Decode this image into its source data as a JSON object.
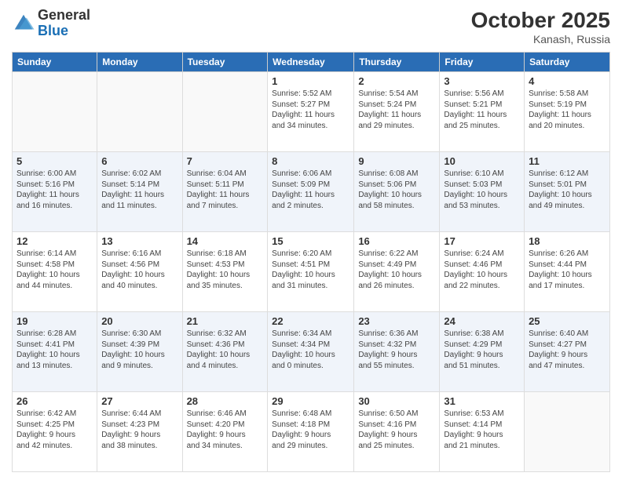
{
  "header": {
    "logo_general": "General",
    "logo_blue": "Blue",
    "title": "October 2025",
    "location": "Kanash, Russia"
  },
  "days_of_week": [
    "Sunday",
    "Monday",
    "Tuesday",
    "Wednesday",
    "Thursday",
    "Friday",
    "Saturday"
  ],
  "weeks": [
    [
      {
        "day": "",
        "info": ""
      },
      {
        "day": "",
        "info": ""
      },
      {
        "day": "",
        "info": ""
      },
      {
        "day": "1",
        "info": "Sunrise: 5:52 AM\nSunset: 5:27 PM\nDaylight: 11 hours\nand 34 minutes."
      },
      {
        "day": "2",
        "info": "Sunrise: 5:54 AM\nSunset: 5:24 PM\nDaylight: 11 hours\nand 29 minutes."
      },
      {
        "day": "3",
        "info": "Sunrise: 5:56 AM\nSunset: 5:21 PM\nDaylight: 11 hours\nand 25 minutes."
      },
      {
        "day": "4",
        "info": "Sunrise: 5:58 AM\nSunset: 5:19 PM\nDaylight: 11 hours\nand 20 minutes."
      }
    ],
    [
      {
        "day": "5",
        "info": "Sunrise: 6:00 AM\nSunset: 5:16 PM\nDaylight: 11 hours\nand 16 minutes."
      },
      {
        "day": "6",
        "info": "Sunrise: 6:02 AM\nSunset: 5:14 PM\nDaylight: 11 hours\nand 11 minutes."
      },
      {
        "day": "7",
        "info": "Sunrise: 6:04 AM\nSunset: 5:11 PM\nDaylight: 11 hours\nand 7 minutes."
      },
      {
        "day": "8",
        "info": "Sunrise: 6:06 AM\nSunset: 5:09 PM\nDaylight: 11 hours\nand 2 minutes."
      },
      {
        "day": "9",
        "info": "Sunrise: 6:08 AM\nSunset: 5:06 PM\nDaylight: 10 hours\nand 58 minutes."
      },
      {
        "day": "10",
        "info": "Sunrise: 6:10 AM\nSunset: 5:03 PM\nDaylight: 10 hours\nand 53 minutes."
      },
      {
        "day": "11",
        "info": "Sunrise: 6:12 AM\nSunset: 5:01 PM\nDaylight: 10 hours\nand 49 minutes."
      }
    ],
    [
      {
        "day": "12",
        "info": "Sunrise: 6:14 AM\nSunset: 4:58 PM\nDaylight: 10 hours\nand 44 minutes."
      },
      {
        "day": "13",
        "info": "Sunrise: 6:16 AM\nSunset: 4:56 PM\nDaylight: 10 hours\nand 40 minutes."
      },
      {
        "day": "14",
        "info": "Sunrise: 6:18 AM\nSunset: 4:53 PM\nDaylight: 10 hours\nand 35 minutes."
      },
      {
        "day": "15",
        "info": "Sunrise: 6:20 AM\nSunset: 4:51 PM\nDaylight: 10 hours\nand 31 minutes."
      },
      {
        "day": "16",
        "info": "Sunrise: 6:22 AM\nSunset: 4:49 PM\nDaylight: 10 hours\nand 26 minutes."
      },
      {
        "day": "17",
        "info": "Sunrise: 6:24 AM\nSunset: 4:46 PM\nDaylight: 10 hours\nand 22 minutes."
      },
      {
        "day": "18",
        "info": "Sunrise: 6:26 AM\nSunset: 4:44 PM\nDaylight: 10 hours\nand 17 minutes."
      }
    ],
    [
      {
        "day": "19",
        "info": "Sunrise: 6:28 AM\nSunset: 4:41 PM\nDaylight: 10 hours\nand 13 minutes."
      },
      {
        "day": "20",
        "info": "Sunrise: 6:30 AM\nSunset: 4:39 PM\nDaylight: 10 hours\nand 9 minutes."
      },
      {
        "day": "21",
        "info": "Sunrise: 6:32 AM\nSunset: 4:36 PM\nDaylight: 10 hours\nand 4 minutes."
      },
      {
        "day": "22",
        "info": "Sunrise: 6:34 AM\nSunset: 4:34 PM\nDaylight: 10 hours\nand 0 minutes."
      },
      {
        "day": "23",
        "info": "Sunrise: 6:36 AM\nSunset: 4:32 PM\nDaylight: 9 hours\nand 55 minutes."
      },
      {
        "day": "24",
        "info": "Sunrise: 6:38 AM\nSunset: 4:29 PM\nDaylight: 9 hours\nand 51 minutes."
      },
      {
        "day": "25",
        "info": "Sunrise: 6:40 AM\nSunset: 4:27 PM\nDaylight: 9 hours\nand 47 minutes."
      }
    ],
    [
      {
        "day": "26",
        "info": "Sunrise: 6:42 AM\nSunset: 4:25 PM\nDaylight: 9 hours\nand 42 minutes."
      },
      {
        "day": "27",
        "info": "Sunrise: 6:44 AM\nSunset: 4:23 PM\nDaylight: 9 hours\nand 38 minutes."
      },
      {
        "day": "28",
        "info": "Sunrise: 6:46 AM\nSunset: 4:20 PM\nDaylight: 9 hours\nand 34 minutes."
      },
      {
        "day": "29",
        "info": "Sunrise: 6:48 AM\nSunset: 4:18 PM\nDaylight: 9 hours\nand 29 minutes."
      },
      {
        "day": "30",
        "info": "Sunrise: 6:50 AM\nSunset: 4:16 PM\nDaylight: 9 hours\nand 25 minutes."
      },
      {
        "day": "31",
        "info": "Sunrise: 6:53 AM\nSunset: 4:14 PM\nDaylight: 9 hours\nand 21 minutes."
      },
      {
        "day": "",
        "info": ""
      }
    ]
  ]
}
